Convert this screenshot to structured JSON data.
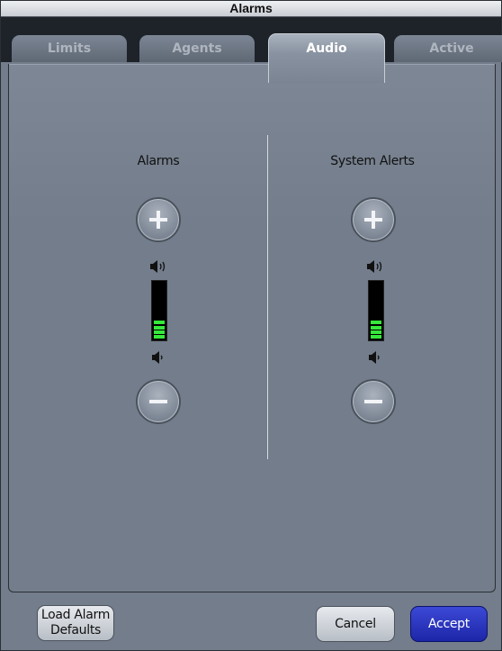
{
  "window": {
    "title": "Alarms"
  },
  "tabs": [
    {
      "label": "Limits",
      "active": false
    },
    {
      "label": "Agents",
      "active": false
    },
    {
      "label": "Audio",
      "active": true
    },
    {
      "label": "Active",
      "active": false
    }
  ],
  "audio": {
    "alarms": {
      "title": "Alarms",
      "volume_level_segments": 4,
      "meter_total_segments": 12
    },
    "system_alerts": {
      "title": "System Alerts",
      "volume_level_segments": 4,
      "meter_total_segments": 12
    }
  },
  "icons": {
    "increase": "plus-icon",
    "decrease": "minus-icon",
    "loud": "speaker-loud-icon",
    "quiet": "speaker-quiet-icon"
  },
  "footer": {
    "load_defaults_line1": "Load Alarm",
    "load_defaults_line2": "Defaults",
    "cancel_label": "Cancel",
    "accept_label": "Accept"
  },
  "colors": {
    "meter_fill": "#35e83a",
    "accept_button": "#2633c4",
    "panel_background": "#737d8b"
  }
}
